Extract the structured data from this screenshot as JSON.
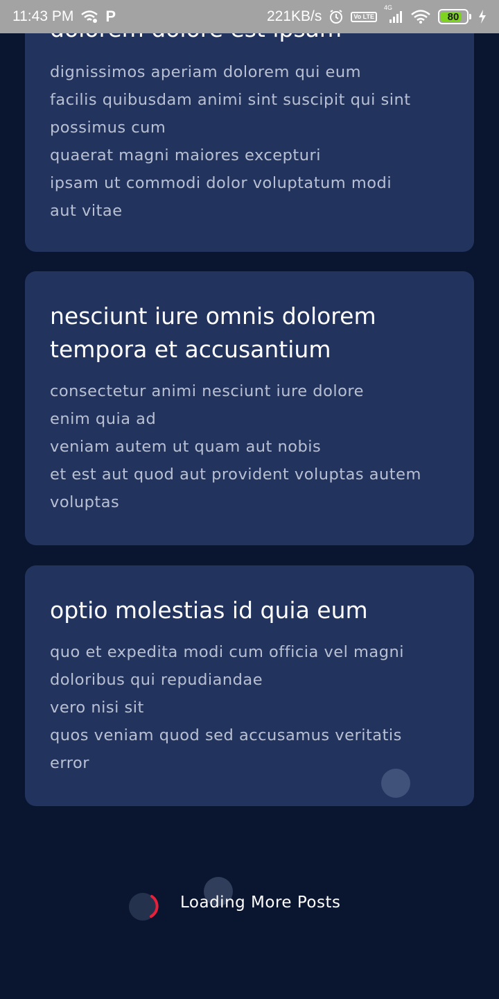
{
  "status_bar": {
    "time": "11:43 PM",
    "speed": "221KB/s",
    "network": "4G",
    "volte": "Vo LTE",
    "battery": "80",
    "battery_level": 0.8,
    "battery_color": "#7fd321",
    "icons": [
      "wifi-hotspot-icon",
      "p-app-icon",
      "alarm-icon",
      "signal-icon",
      "wifi-icon",
      "charging-icon"
    ]
  },
  "posts": [
    {
      "title": "dolorem dolore est ipsam",
      "body": "dignissimos aperiam dolorem qui eum\nfacilis quibusdam animi sint suscipit qui sint\npossimus cum\nquaerat magni maiores excepturi\nipsam ut commodi dolor voluptatum modi\naut vitae"
    },
    {
      "title": "nesciunt iure omnis dolorem tempora et accusantium",
      "body": "consectetur animi nesciunt iure dolore\nenim quia ad\nveniam autem ut quam aut nobis\net est aut quod aut provident voluptas autem\nvoluptas"
    },
    {
      "title": "optio molestias id quia eum",
      "body": "quo et expedita modi cum officia vel magni\ndoloribus qui repudiandae\nvero nisi sit\nquos veniam quod sed accusamus veritatis\nerror"
    }
  ],
  "loading": {
    "label": "Loading More Posts",
    "spinner_color": "#e8203a"
  },
  "colors": {
    "background": "#0a1530",
    "card": "#22345e",
    "title": "#ffffff",
    "body": "#b9c0d3"
  }
}
